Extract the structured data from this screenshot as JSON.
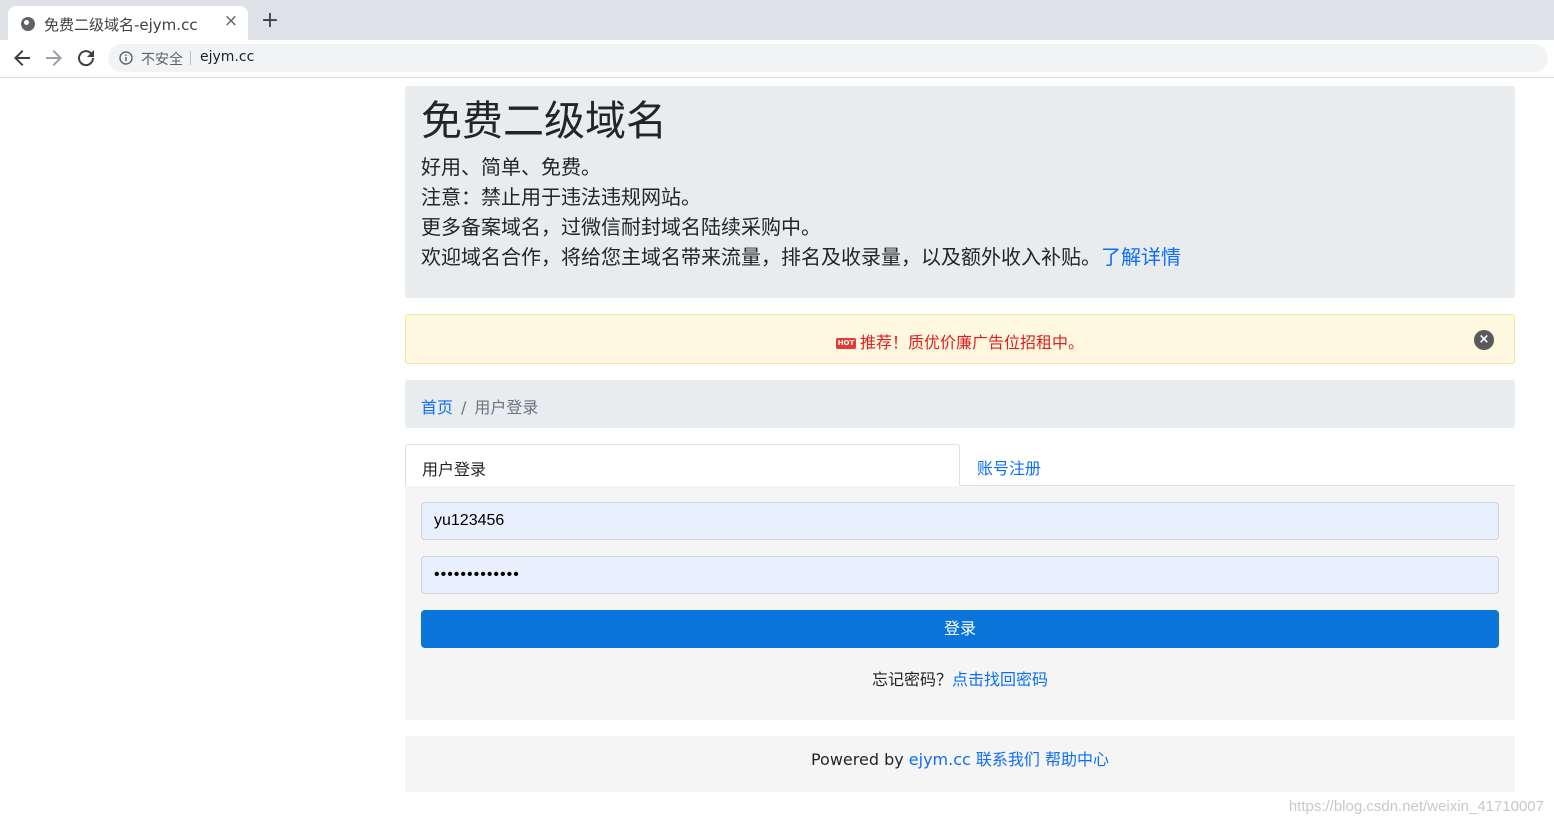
{
  "browser": {
    "tab_title": "免费二级域名-ejym.cc",
    "tab_close": "×",
    "new_tab": "+",
    "security_label": "不安全",
    "url": "ejym.cc"
  },
  "jumbotron": {
    "title": "免费二级域名",
    "lines": [
      "好用、简单、免费。",
      "注意：禁止用于违法违规网站。",
      "更多备案域名，过微信耐封域名陆续采购中。",
      "欢迎域名合作，将给您主域名带来流量，排名及收录量，以及额外收入补贴。"
    ],
    "details_link": "了解详情"
  },
  "alert": {
    "badge": "HOT",
    "text": "推荐！质优价廉广告位招租中。",
    "close": "×"
  },
  "breadcrumb": {
    "home": "首页",
    "separator": "/",
    "current": "用户登录"
  },
  "tabs": {
    "login": "用户登录",
    "register": "账号注册"
  },
  "form": {
    "username": "yu123456",
    "password_masked": "•••••••••••••",
    "login_button": "登录",
    "forgot_prefix": "忘记密码？",
    "forgot_link": "点击找回密码"
  },
  "footer": {
    "powered_by": "Powered by ",
    "site_link": "ejym.cc",
    "contact": "联系我们",
    "help": "帮助中心"
  },
  "watermark": "https://blog.csdn.net/weixin_41710007",
  "colors": {
    "link": "#0d6efd",
    "primary_button": "#0a74da",
    "alert_text": "#e02020"
  }
}
